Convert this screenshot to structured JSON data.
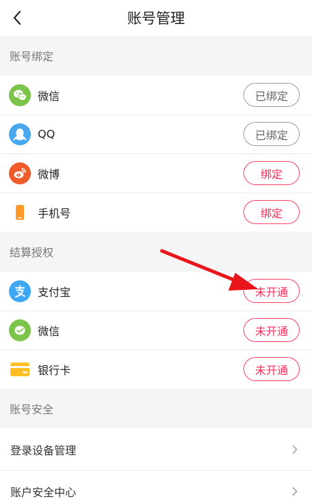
{
  "header": {
    "title": "账号管理",
    "back_icon": "chevron-left-icon"
  },
  "sections": {
    "binding": {
      "title": "账号绑定",
      "items": [
        {
          "label": "微信",
          "icon": "wechat-icon",
          "color": "#7cc44a",
          "button": "已绑定",
          "state": "bound"
        },
        {
          "label": "QQ",
          "icon": "qq-icon",
          "color": "#49a9ee",
          "button": "已绑定",
          "state": "bound"
        },
        {
          "label": "微博",
          "icon": "weibo-icon",
          "color": "#f15a29",
          "button": "绑定",
          "state": "unbound"
        },
        {
          "label": "手机号",
          "icon": "phone-icon",
          "color": "#ff9a2a",
          "button": "绑定",
          "state": "unbound"
        }
      ]
    },
    "settlement": {
      "title": "结算授权",
      "items": [
        {
          "label": "支付宝",
          "icon": "alipay-icon",
          "color": "#3fa8f4",
          "button": "未开通",
          "state": "unbound"
        },
        {
          "label": "微信",
          "icon": "wechat-pay-icon",
          "color": "#7cc44a",
          "button": "未开通",
          "state": "unbound"
        },
        {
          "label": "银行卡",
          "icon": "bank-card-icon",
          "color": "#ffbf24",
          "button": "未开通",
          "state": "unbound"
        }
      ]
    },
    "security": {
      "title": "账号安全",
      "items": [
        {
          "label": "登录设备管理"
        },
        {
          "label": "账户安全中心"
        }
      ]
    }
  },
  "colors": {
    "accent": "#ff2a57",
    "arrow": "#e8151b",
    "background": "#f5f5f5"
  }
}
